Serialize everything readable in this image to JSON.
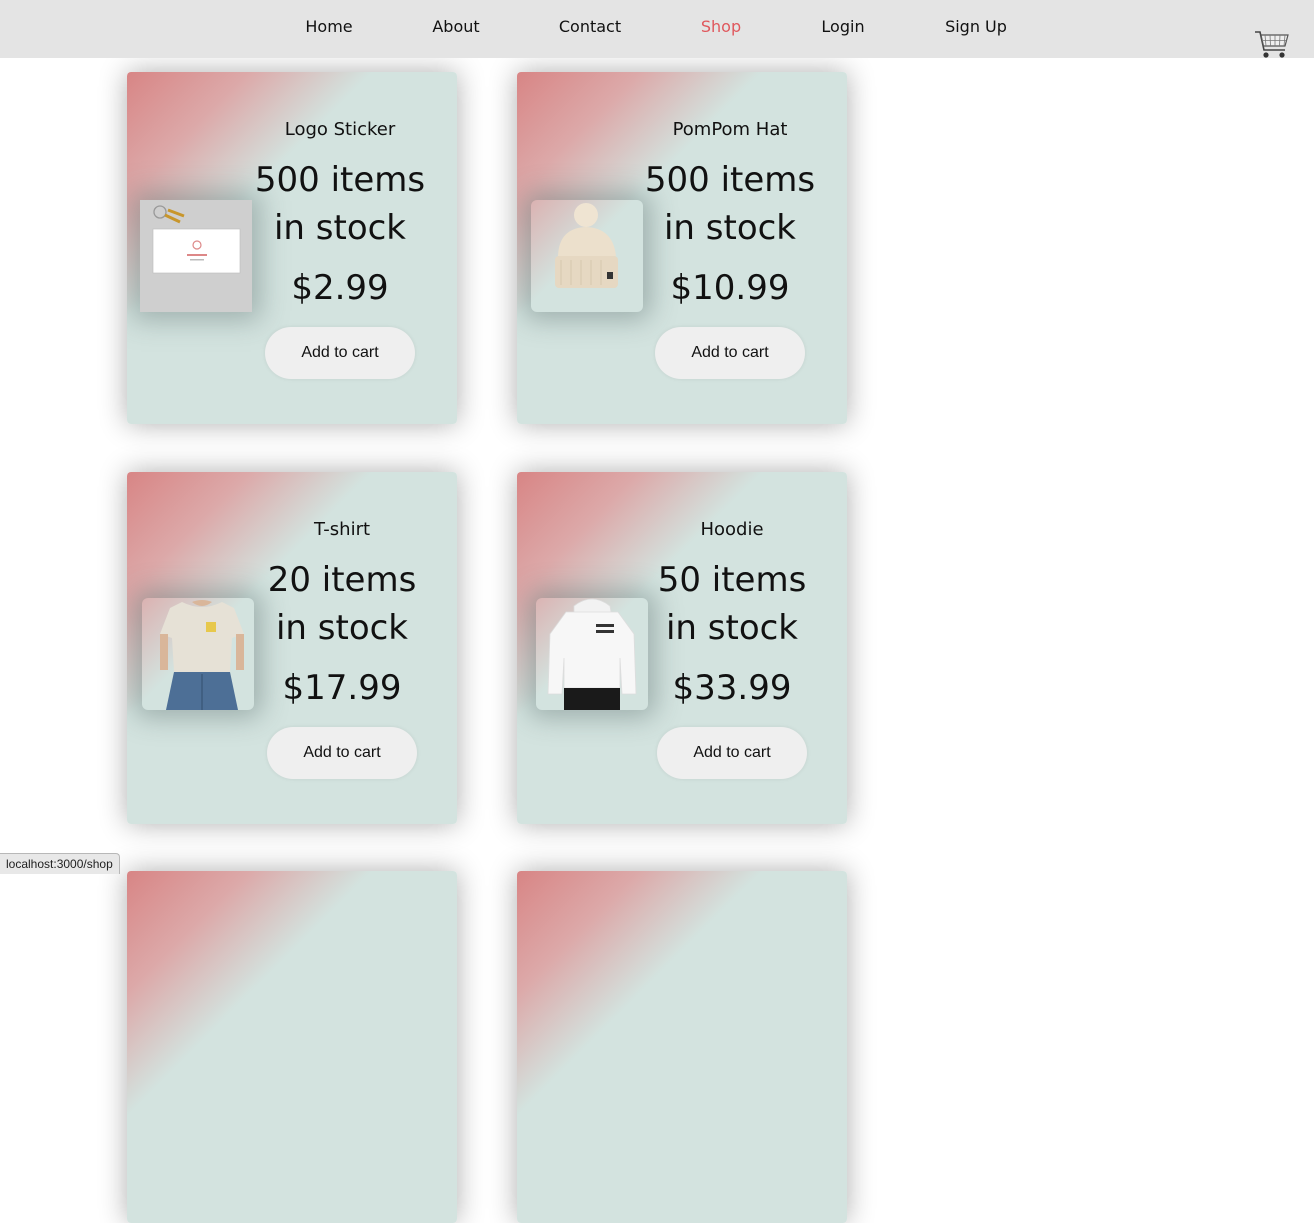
{
  "nav": {
    "items": [
      {
        "label": "Home"
      },
      {
        "label": "About"
      },
      {
        "label": "Contact"
      },
      {
        "label": "Shop",
        "active": true
      },
      {
        "label": "Login"
      },
      {
        "label": "Sign Up"
      }
    ],
    "active_color": "#e0585d",
    "background_color": "#e4e4e4",
    "cart_icon": "shopping-cart-icon"
  },
  "products": [
    {
      "name": "Logo Sticker",
      "stock_line1": "500 items",
      "stock_line2": "in stock",
      "price": "$2.99",
      "button_label": "Add to cart",
      "image_icon": "logo-sticker-image"
    },
    {
      "name": "PomPom Hat",
      "stock_line1": "500 items",
      "stock_line2": "in stock",
      "price": "$10.99",
      "button_label": "Add to cart",
      "image_icon": "pompom-hat-image"
    },
    {
      "name": "T-shirt",
      "stock_line1": "20 items",
      "stock_line2": "in stock",
      "price": "$17.99",
      "button_label": "Add to cart",
      "image_icon": "tshirt-image"
    },
    {
      "name": "Hoodie",
      "stock_line1": "50 items",
      "stock_line2": "in stock",
      "price": "$33.99",
      "button_label": "Add to cart",
      "image_icon": "hoodie-image"
    }
  ],
  "card_colors": {
    "accent": "#d88585",
    "background": "#d3e3df",
    "button": "#efefef"
  },
  "status_bar": {
    "url": "localhost:3000/shop"
  }
}
